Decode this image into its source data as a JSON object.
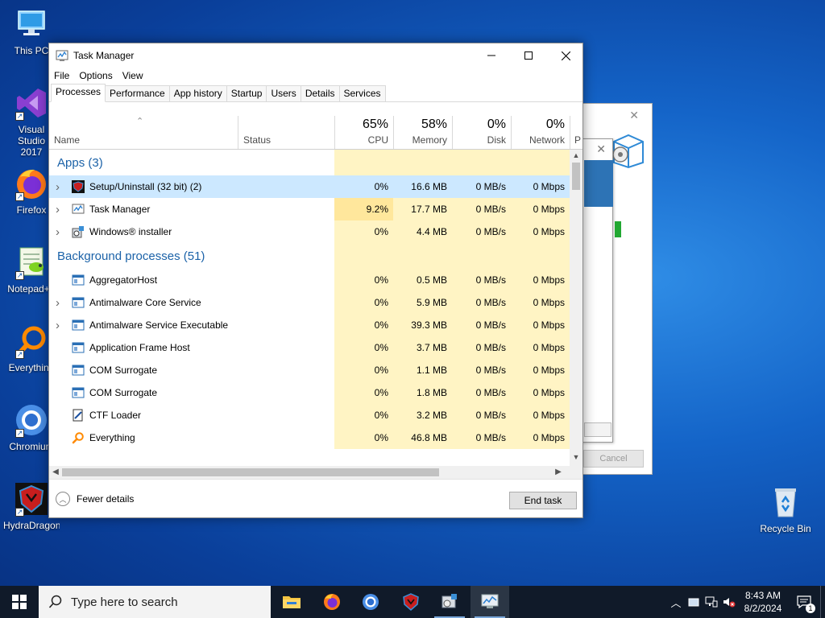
{
  "desktop": {
    "icons": [
      {
        "label": "This PC"
      },
      {
        "label": "Visual Studio 2017"
      },
      {
        "label": "Firefox"
      },
      {
        "label": "Notepad++"
      },
      {
        "label": "Everything"
      },
      {
        "label": "Chromium"
      },
      {
        "label": "HydraDragon"
      },
      {
        "label": "Recycle Bin"
      }
    ],
    "bg_installer": {
      "cancel_label": "Cancel"
    }
  },
  "taskmanager": {
    "title": "Task Manager",
    "menu": [
      "File",
      "Options",
      "View"
    ],
    "tabs": [
      "Processes",
      "Performance",
      "App history",
      "Startup",
      "Users",
      "Details",
      "Services"
    ],
    "active_tab": "Processes",
    "columns": {
      "name": "Name",
      "status": "Status",
      "cpu": {
        "pct": "65%",
        "label": "CPU"
      },
      "memory": {
        "pct": "58%",
        "label": "Memory"
      },
      "disk": {
        "pct": "0%",
        "label": "Disk"
      },
      "network": {
        "pct": "0%",
        "label": "Network"
      },
      "power": {
        "label": "P"
      }
    },
    "groups": {
      "apps": "Apps (3)",
      "background": "Background processes (51)"
    },
    "apps": [
      {
        "name": "Setup/Uninstall (32 bit) (2)",
        "cpu": "0%",
        "memory": "16.6 MB",
        "disk": "0 MB/s",
        "network": "0 Mbps",
        "expandable": true,
        "icon": "hydradragon-icon"
      },
      {
        "name": "Task Manager",
        "cpu": "9.2%",
        "memory": "17.7 MB",
        "disk": "0 MB/s",
        "network": "0 Mbps",
        "expandable": true,
        "icon": "taskmanager-icon"
      },
      {
        "name": "Windows® installer",
        "cpu": "0%",
        "memory": "4.4 MB",
        "disk": "0 MB/s",
        "network": "0 Mbps",
        "expandable": true,
        "icon": "installer-icon"
      }
    ],
    "background": [
      {
        "name": "AggregatorHost",
        "cpu": "0%",
        "memory": "0.5 MB",
        "disk": "0 MB/s",
        "network": "0 Mbps",
        "expandable": false,
        "icon": "service-icon"
      },
      {
        "name": "Antimalware Core Service",
        "cpu": "0%",
        "memory": "5.9 MB",
        "disk": "0 MB/s",
        "network": "0 Mbps",
        "expandable": true,
        "icon": "service-icon"
      },
      {
        "name": "Antimalware Service Executable",
        "cpu": "0%",
        "memory": "39.3 MB",
        "disk": "0 MB/s",
        "network": "0 Mbps",
        "expandable": true,
        "icon": "service-icon"
      },
      {
        "name": "Application Frame Host",
        "cpu": "0%",
        "memory": "3.7 MB",
        "disk": "0 MB/s",
        "network": "0 Mbps",
        "expandable": false,
        "icon": "service-icon"
      },
      {
        "name": "COM Surrogate",
        "cpu": "0%",
        "memory": "1.1 MB",
        "disk": "0 MB/s",
        "network": "0 Mbps",
        "expandable": false,
        "icon": "service-icon"
      },
      {
        "name": "COM Surrogate",
        "cpu": "0%",
        "memory": "1.8 MB",
        "disk": "0 MB/s",
        "network": "0 Mbps",
        "expandable": false,
        "icon": "service-icon"
      },
      {
        "name": "CTF Loader",
        "cpu": "0%",
        "memory": "3.2 MB",
        "disk": "0 MB/s",
        "network": "0 Mbps",
        "expandable": false,
        "icon": "ctf-icon"
      },
      {
        "name": "Everything",
        "cpu": "0%",
        "memory": "46.8 MB",
        "disk": "0 MB/s",
        "network": "0 Mbps",
        "expandable": false,
        "icon": "everything-icon"
      }
    ],
    "footer": {
      "fewer_details": "Fewer details",
      "end_task": "End task"
    }
  },
  "taskbar": {
    "search_placeholder": "Type here to search",
    "time": "8:43 AM",
    "date": "8/2/2024",
    "notification_count": "1"
  },
  "colors": {
    "heat_light": "#fff4c4",
    "heat_medium": "#ffe79c",
    "selected_row": "#cce8ff",
    "group_title": "#1b62a8",
    "taskbar_bg": "#101a29"
  }
}
